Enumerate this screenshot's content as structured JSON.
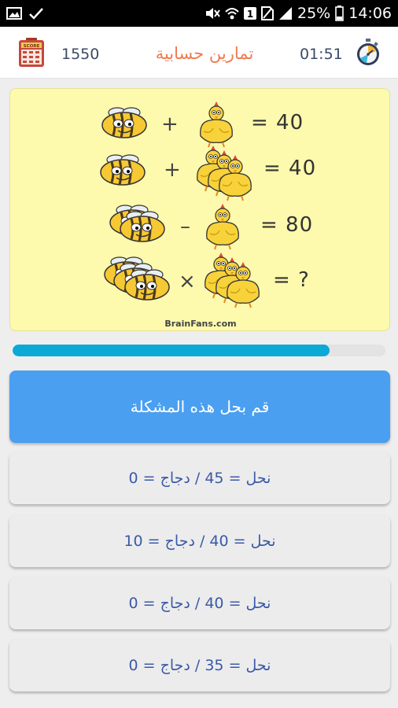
{
  "status_bar": {
    "battery": "25%",
    "time": "14:06",
    "notification_count": "1"
  },
  "header": {
    "score_icon_label": "SCORE",
    "score": "1550",
    "title": "تمارين حسابية",
    "timer": "01:51"
  },
  "puzzle": {
    "rows": [
      {
        "op1": "+",
        "result": "= 40"
      },
      {
        "op1": "+",
        "result": "= 40"
      },
      {
        "op1": "–",
        "result": "= 80"
      },
      {
        "op1": "×",
        "result": "= ?"
      }
    ],
    "watermark": "BrainFans.com"
  },
  "progress": {
    "fraction": 0.85
  },
  "question": "قم بحل هذه المشكلة",
  "answers": [
    "نحل = 45 / دجاج = 0",
    "نحل = 40 / دجاج = 10",
    "نحل = 40 / دجاج = 0",
    "نحل = 35 / دجاج = 0"
  ],
  "colors": {
    "accent": "#4a9ff0",
    "progress": "#0aa9d6",
    "title": "#f07a50",
    "card": "#fdf9ad",
    "answer_text": "#3a5aa8"
  },
  "icons": [
    "image-icon",
    "check-icon",
    "mute-icon",
    "wifi-icon",
    "notification-badge-icon",
    "sim-icon",
    "signal-icon",
    "battery-icon",
    "score-board-icon",
    "stopwatch-icon",
    "bee-icon",
    "chicken-icon"
  ]
}
